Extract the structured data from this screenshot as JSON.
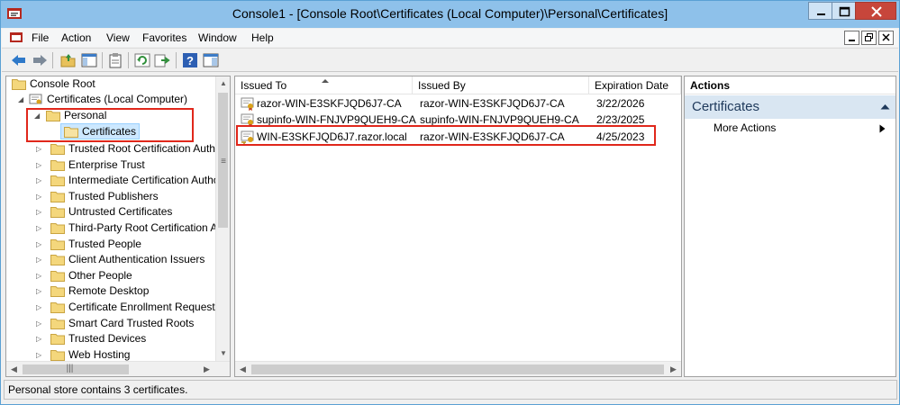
{
  "window": {
    "title": "Console1 - [Console Root\\Certificates (Local Computer)\\Personal\\Certificates]"
  },
  "menu": {
    "items": [
      "File",
      "Action",
      "View",
      "Favorites",
      "Window",
      "Help"
    ]
  },
  "toolbar": {
    "icons": [
      "back-icon",
      "forward-icon",
      "up-folder-icon",
      "show-hide-tree-icon",
      "clipboard-icon",
      "refresh-icon",
      "export-icon",
      "help-icon",
      "action-pane-icon"
    ]
  },
  "tree": {
    "root": "Console Root",
    "computer": "Certificates (Local Computer)",
    "personal": "Personal",
    "certificates": "Certificates",
    "stores": [
      "Trusted Root Certification Autho",
      "Enterprise Trust",
      "Intermediate Certification Autho",
      "Trusted Publishers",
      "Untrusted Certificates",
      "Third-Party Root Certification Au",
      "Trusted People",
      "Client Authentication Issuers",
      "Other People",
      "Remote Desktop",
      "Certificate Enrollment Requests",
      "Smart Card Trusted Roots",
      "Trusted Devices",
      "Web Hosting"
    ]
  },
  "list": {
    "columns": [
      "Issued To",
      "Issued By",
      "Expiration Date"
    ],
    "rows": [
      {
        "issued_to": "razor-WIN-E3SKFJQD6J7-CA",
        "issued_by": "razor-WIN-E3SKFJQD6J7-CA",
        "expiration": "3/22/2026"
      },
      {
        "issued_to": "supinfo-WIN-FNJVP9QUEH9-CA",
        "issued_by": "supinfo-WIN-FNJVP9QUEH9-CA",
        "expiration": "2/23/2025"
      },
      {
        "issued_to": "WIN-E3SKFJQD6J7.razor.local",
        "issued_by": "razor-WIN-E3SKFJQD6J7-CA",
        "expiration": "4/25/2023"
      }
    ]
  },
  "actions": {
    "header": "Actions",
    "section": "Certificates",
    "more": "More Actions"
  },
  "status": {
    "text": "Personal store contains 3 certificates."
  },
  "colors": {
    "titlebar": "#8ec1ea",
    "close_button": "#c7463b",
    "highlight": "#e0271b",
    "actions_section": "#d9e6f2"
  }
}
